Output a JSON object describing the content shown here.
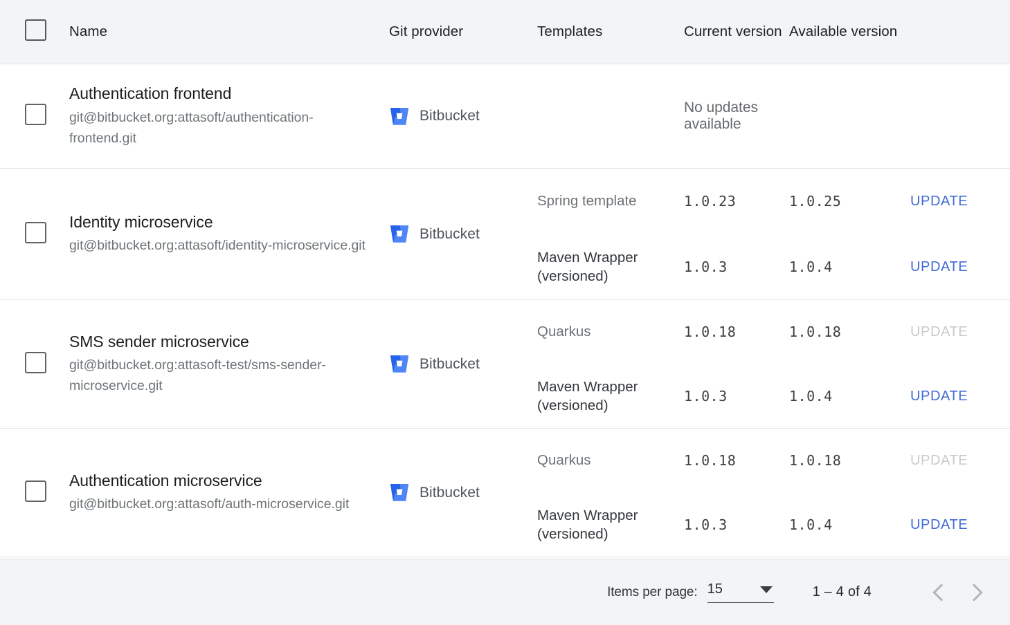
{
  "table": {
    "columns": {
      "select_all": "",
      "name": "Name",
      "git_provider": "Git provider",
      "templates": "Templates",
      "current_version": "Current version",
      "available_version": "Available version",
      "actions": ""
    },
    "rows": [
      {
        "name": "Authentication frontend",
        "url": "git@bitbucket.org:attasoft/authentication-frontend.git",
        "git_provider": "Bitbucket",
        "git_provider_icon": "bitbucket-icon",
        "status_message": "No updates available",
        "templates": []
      },
      {
        "name": "Identity microservice",
        "url": "git@bitbucket.org:attasoft/identity-microservice.git",
        "git_provider": "Bitbucket",
        "git_provider_icon": "bitbucket-icon",
        "status_message": "",
        "templates": [
          {
            "template": "Spring template",
            "emphasis": "light",
            "current_version": "1.0.23",
            "available_version": "1.0.25",
            "action_label": "UPDATE",
            "action_enabled": true
          },
          {
            "template": "Maven Wrapper (versioned)",
            "emphasis": "dark",
            "current_version": "1.0.3",
            "available_version": "1.0.4",
            "action_label": "UPDATE",
            "action_enabled": true
          }
        ]
      },
      {
        "name": "SMS sender microservice",
        "url": "git@bitbucket.org:attasoft-test/sms-sender-microservice.git",
        "git_provider": "Bitbucket",
        "git_provider_icon": "bitbucket-icon",
        "status_message": "",
        "templates": [
          {
            "template": "Quarkus",
            "emphasis": "light",
            "current_version": "1.0.18",
            "available_version": "1.0.18",
            "action_label": "UPDATE",
            "action_enabled": false
          },
          {
            "template": "Maven Wrapper (versioned)",
            "emphasis": "dark",
            "current_version": "1.0.3",
            "available_version": "1.0.4",
            "action_label": "UPDATE",
            "action_enabled": true
          }
        ]
      },
      {
        "name": "Authentication microservice",
        "url": "git@bitbucket.org:attasoft/auth-microservice.git",
        "git_provider": "Bitbucket",
        "git_provider_icon": "bitbucket-icon",
        "status_message": "",
        "templates": [
          {
            "template": "Quarkus",
            "emphasis": "light",
            "current_version": "1.0.18",
            "available_version": "1.0.18",
            "action_label": "UPDATE",
            "action_enabled": false
          },
          {
            "template": "Maven Wrapper (versioned)",
            "emphasis": "dark",
            "current_version": "1.0.3",
            "available_version": "1.0.4",
            "action_label": "UPDATE",
            "action_enabled": true
          }
        ]
      }
    ]
  },
  "paginator": {
    "items_per_page_label": "Items per page:",
    "items_per_page_value": "15",
    "items_per_page_options": [
      "15"
    ],
    "range_label": "1 – 4 of 4",
    "previous_icon": "chevron-left-icon",
    "next_icon": "chevron-right-icon",
    "previous_enabled": false,
    "next_enabled": false
  },
  "colors": {
    "header_bg": "#f3f4f5",
    "row_bg": "#ffffff",
    "divider": "#e4e5e7",
    "link_blue": "#3f6ad4",
    "link_disabled": "#c9cace",
    "bitbucket_blue_dark": "#2563eb",
    "bitbucket_blue_light": "#4f86f7",
    "text_primary": "#1c1d1f",
    "text_secondary": "#6e7478"
  }
}
